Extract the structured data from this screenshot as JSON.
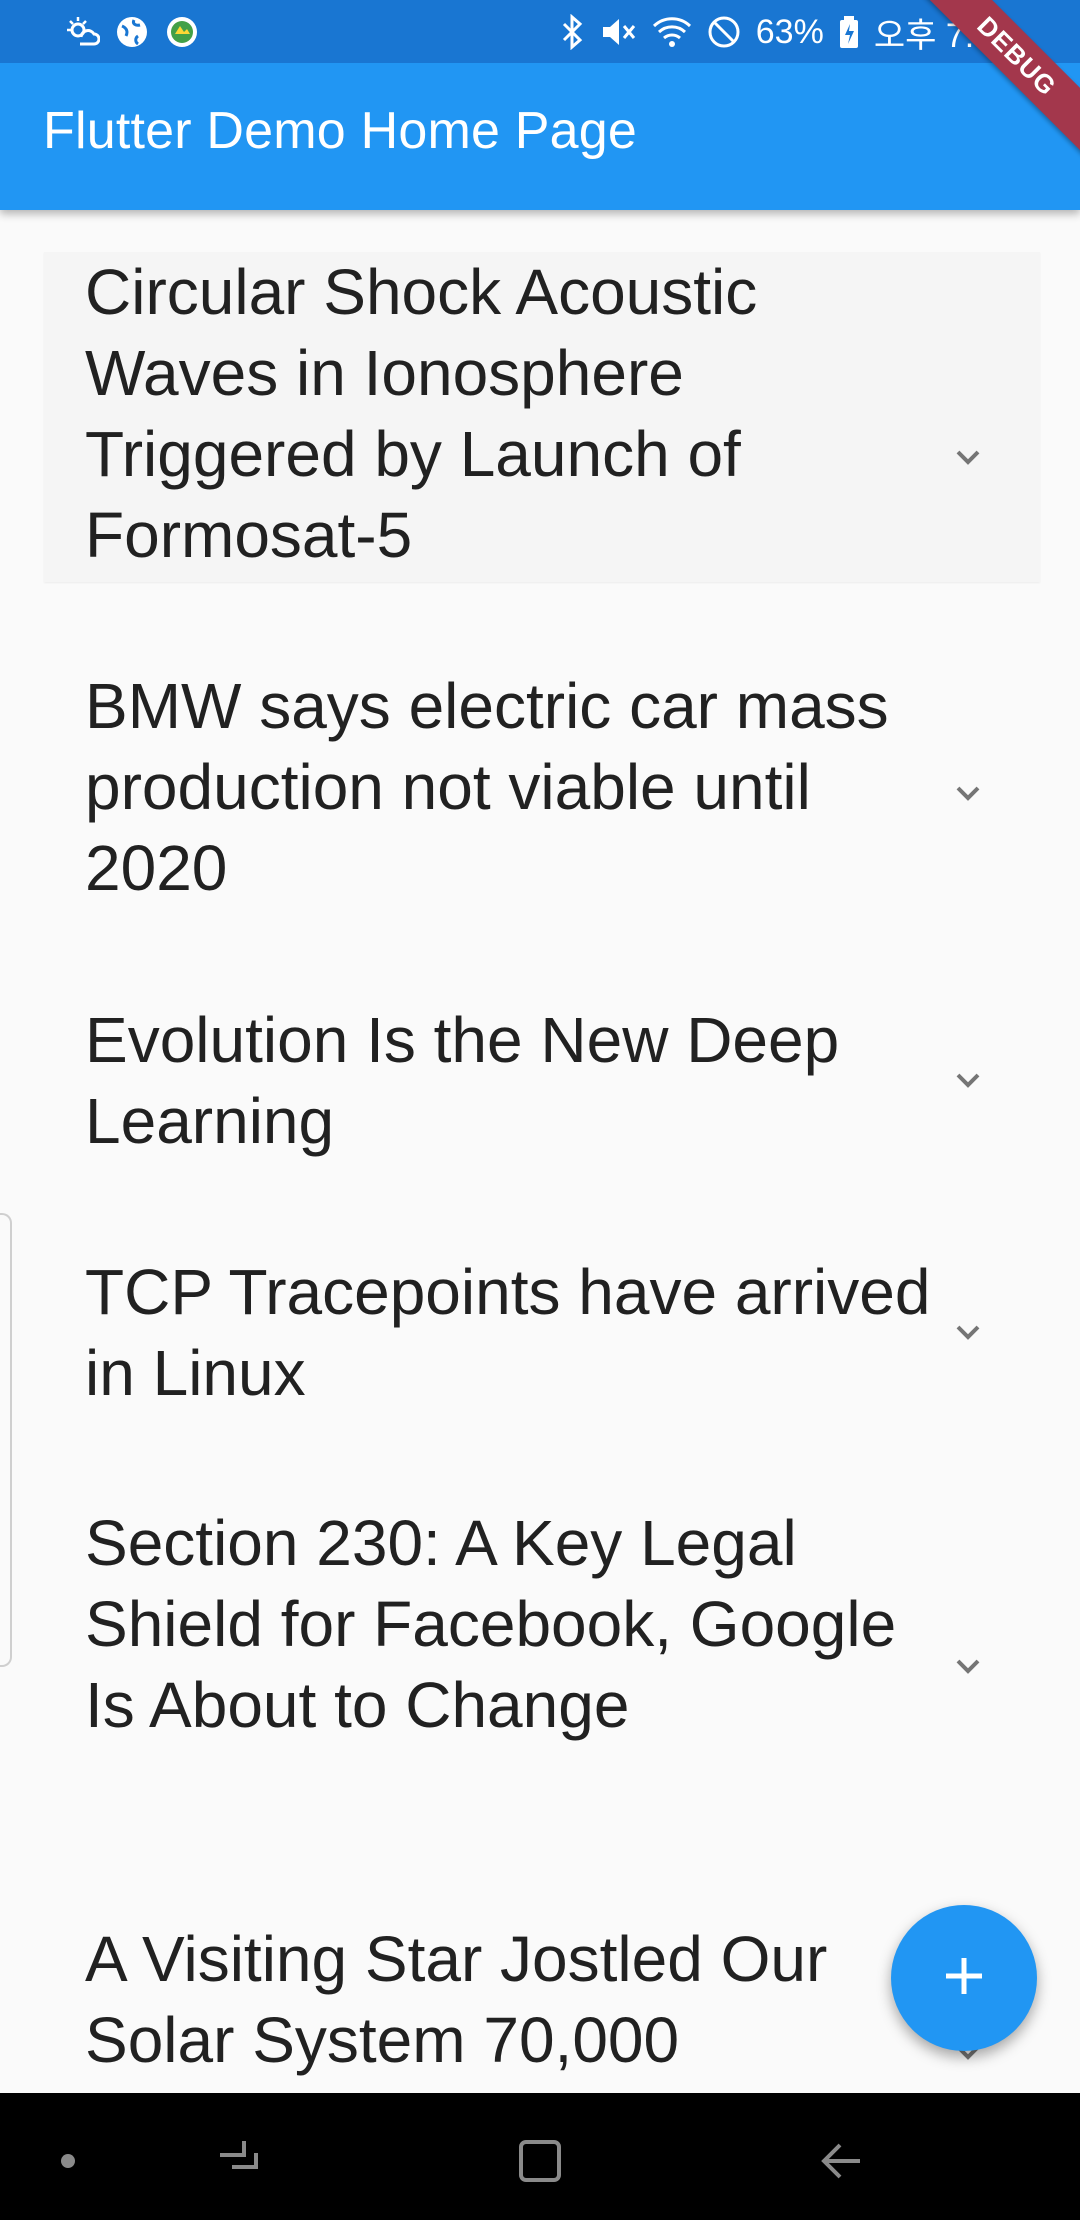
{
  "status_bar": {
    "battery": "63%",
    "time": "오후 7:48",
    "icons": [
      "weather-icon",
      "globe-icon",
      "app-icon",
      "bluetooth-icon",
      "mute-icon",
      "wifi-icon",
      "do-not-disturb-icon",
      "battery-icon"
    ]
  },
  "debug_banner": "DEBUG",
  "app_bar": {
    "title": "Flutter Demo Home Page"
  },
  "list": {
    "items": [
      {
        "title": "Circular Shock Acoustic Waves in Ionosphere Triggered by Launch of Formosat-5"
      },
      {
        "title": "BMW says electric car mass production not viable until 2020"
      },
      {
        "title": "Evolution Is the New Deep Learning"
      },
      {
        "title": "TCP Tracepoints have arrived in Linux"
      },
      {
        "title": "Section 230: A Key Legal Shield for Facebook, Google Is About to Change"
      },
      {
        "title": "A Visiting Star Jostled Our Solar System 70,000"
      }
    ]
  },
  "fab": {
    "icon": "plus-icon"
  },
  "nav_bar": {
    "icons": [
      "dot-icon",
      "recents-icon",
      "home-icon",
      "back-icon"
    ]
  },
  "colors": {
    "status_bar": "#1976d2",
    "app_bar": "#2196f3",
    "fab": "#2196f3",
    "debug_banner": "#a3374c",
    "background": "#fafafa"
  }
}
